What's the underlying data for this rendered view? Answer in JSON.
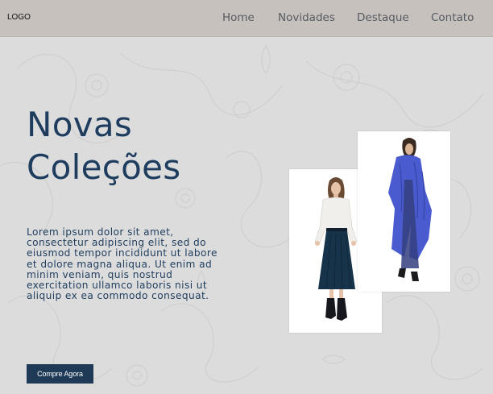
{
  "header": {
    "logo": "LOGO",
    "nav": [
      {
        "label": "Home"
      },
      {
        "label": "Novidades"
      },
      {
        "label": "Destaque"
      },
      {
        "label": "Contato"
      }
    ]
  },
  "hero": {
    "title_line1": "Novas",
    "title_line2": "Coleções",
    "description": "Lorem ipsum dolor sit amet, consectetur adipiscing elit, sed do eiusmod tempor incididunt ut labore et dolore magna aliqua. Ut enim ad minim veniam, quis nostrud exercitation ullamco laboris nisi ut aliquip ex ea commodo consequat.",
    "cta_label": "Compre Agora"
  },
  "colors": {
    "header_bg": "#c7c1bd",
    "page_bg": "#dcdcdc",
    "accent": "#1e3d5e",
    "button_bg": "#1e3a57"
  },
  "images": [
    {
      "name": "model-white-blouse-navy-skirt"
    },
    {
      "name": "model-blue-fur-coat"
    }
  ]
}
